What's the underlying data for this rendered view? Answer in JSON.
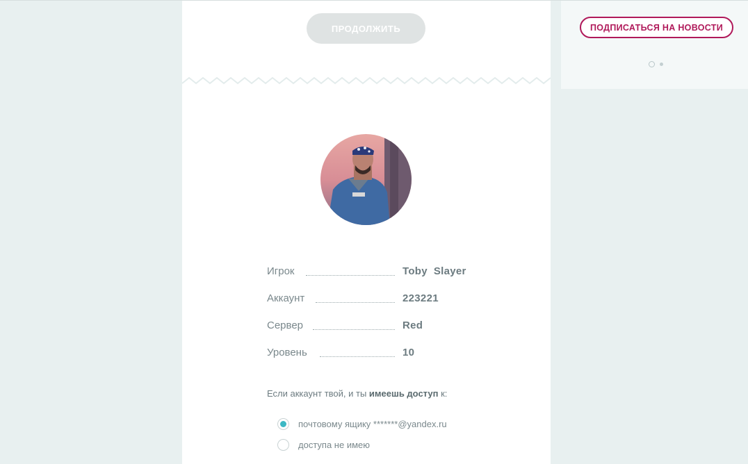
{
  "main": {
    "continue_label": "ПРОДОЛЖИТЬ",
    "info_rows": [
      {
        "label": "Игрок",
        "value": "Toby  Slayer"
      },
      {
        "label": "Аккаунт",
        "value": "223221"
      },
      {
        "label": "Сервер",
        "value": "Red"
      },
      {
        "label": "Уровень",
        "value": "10"
      }
    ],
    "access_prompt": {
      "before": "Если аккаунт твой, и ты ",
      "bold": "имеешь доступ",
      "after": " к:"
    },
    "options": [
      {
        "label": "почтовому ящику *******@yandex.ru",
        "selected": true
      },
      {
        "label": "доступа не имею",
        "selected": false
      }
    ]
  },
  "sidebar": {
    "subscribe_label": "ПОДПИСАТЬСЯ НА НОВОСТИ",
    "pager": {
      "count": 2,
      "active": 0
    }
  },
  "colors": {
    "accent": "#3cb8c4",
    "subscribe": "#b0195a",
    "background": "#e8f0f0"
  }
}
